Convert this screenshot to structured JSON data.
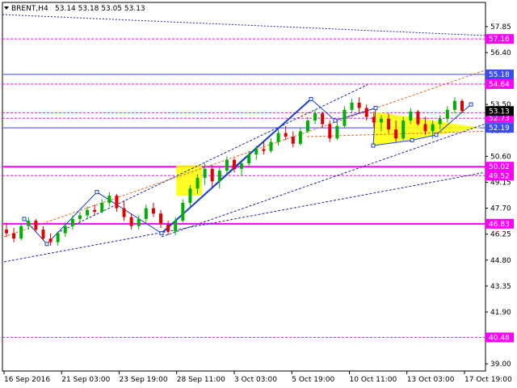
{
  "header": {
    "symbol": "BRENT,H4",
    "ohlc": "53.14 53.18 53.05 53.13"
  },
  "chart_data": {
    "type": "candlestick",
    "price_scale": [
      57.85,
      56.4,
      55.0,
      53.5,
      52.05,
      50.6,
      49.15,
      47.7,
      46.25,
      44.8,
      43.35,
      41.9,
      40.45,
      39.0
    ],
    "ylim": [
      38.6,
      59.2
    ],
    "x_ticks": [
      "16 Sep 2016",
      "21 Sep 03:00",
      "23 Sep 19:00",
      "28 Sep 11:00",
      "3 Oct 03:00",
      "5 Oct 19:00",
      "10 Oct 11:00",
      "13 Oct 03:00",
      "17 Oct 19:00"
    ],
    "levels": [
      {
        "value": 57.16,
        "label": "57.16",
        "color": "#ff00ff",
        "style": "dashed"
      },
      {
        "value": 55.18,
        "label": "55.18",
        "color": "#3b4cf0",
        "style": "solid"
      },
      {
        "value": 54.64,
        "label": "54.64",
        "color": "#ff00ff",
        "style": "dashed"
      },
      {
        "value": 53.03,
        "label": "53.03",
        "color": "#ff00ff",
        "style": "dashed"
      },
      {
        "value": 52.73,
        "label": "52.73",
        "color": "#ff00ff",
        "style": "dashed"
      },
      {
        "value": 52.19,
        "label": "52.19",
        "color": "#3b4cf0",
        "style": "solid"
      },
      {
        "value": 50.02,
        "label": "50.02",
        "color": "#ff00ff",
        "style": "solid"
      },
      {
        "value": 49.52,
        "label": "49.52",
        "color": "#ff00ff",
        "style": "dashed"
      },
      {
        "value": 46.83,
        "label": "46.83",
        "color": "#ff00ff",
        "style": "solid"
      },
      {
        "value": 40.48,
        "label": "40.48",
        "color": "#ff00ff",
        "style": "dashed"
      }
    ],
    "current_price": {
      "value": 53.13,
      "label": "53.13"
    },
    "colors": {
      "bull": "#00b000",
      "bear": "#e00000",
      "wave": "#1a3fd1",
      "channel": "#1a2aa0",
      "fan": "#e06a2a",
      "pattern_fill": "#ffff00"
    },
    "candles": [
      [
        46.5,
        46.9,
        46.1,
        46.3
      ],
      [
        46.3,
        46.6,
        45.8,
        46.0
      ],
      [
        46.0,
        46.8,
        45.9,
        46.7
      ],
      [
        46.7,
        47.2,
        46.5,
        47.0
      ],
      [
        47.0,
        47.1,
        46.4,
        46.5
      ],
      [
        46.5,
        46.7,
        45.9,
        46.0
      ],
      [
        46.0,
        46.3,
        45.6,
        45.8
      ],
      [
        45.8,
        46.4,
        45.6,
        46.3
      ],
      [
        46.3,
        46.9,
        46.1,
        46.7
      ],
      [
        46.7,
        47.3,
        46.5,
        47.1
      ],
      [
        47.1,
        47.5,
        46.8,
        47.3
      ],
      [
        47.3,
        47.8,
        47.1,
        47.6
      ],
      [
        47.6,
        47.9,
        47.3,
        47.5
      ],
      [
        47.5,
        48.2,
        47.4,
        48.0
      ],
      [
        48.0,
        48.6,
        47.8,
        48.4
      ],
      [
        48.4,
        48.5,
        47.5,
        47.7
      ],
      [
        47.7,
        48.1,
        47.0,
        47.2
      ],
      [
        47.2,
        47.4,
        46.5,
        46.7
      ],
      [
        46.7,
        47.3,
        46.5,
        47.1
      ],
      [
        47.1,
        47.9,
        46.9,
        47.7
      ],
      [
        47.7,
        48.0,
        47.2,
        47.4
      ],
      [
        47.4,
        47.6,
        46.6,
        46.8
      ],
      [
        46.8,
        47.0,
        46.2,
        46.4
      ],
      [
        46.4,
        47.2,
        46.2,
        47.0
      ],
      [
        47.0,
        48.2,
        46.9,
        48.0
      ],
      [
        48.0,
        49.0,
        47.8,
        48.8
      ],
      [
        48.8,
        49.6,
        48.5,
        49.4
      ],
      [
        49.4,
        50.2,
        49.0,
        49.9
      ],
      [
        49.9,
        50.1,
        48.9,
        49.2
      ],
      [
        49.2,
        50.0,
        48.8,
        49.8
      ],
      [
        49.8,
        50.6,
        49.6,
        50.4
      ],
      [
        50.4,
        50.5,
        49.7,
        49.9
      ],
      [
        49.9,
        50.3,
        49.5,
        50.2
      ],
      [
        50.2,
        50.9,
        50.0,
        50.7
      ],
      [
        50.7,
        51.2,
        50.4,
        51.0
      ],
      [
        51.0,
        51.4,
        50.7,
        50.9
      ],
      [
        50.9,
        51.6,
        50.8,
        51.4
      ],
      [
        51.4,
        52.1,
        51.2,
        51.9
      ],
      [
        51.9,
        52.3,
        51.5,
        51.7
      ],
      [
        51.7,
        52.0,
        51.1,
        51.3
      ],
      [
        51.3,
        52.2,
        51.2,
        52.0
      ],
      [
        52.0,
        52.8,
        51.9,
        52.6
      ],
      [
        52.6,
        53.2,
        52.4,
        53.0
      ],
      [
        53.0,
        53.1,
        52.2,
        52.4
      ],
      [
        52.4,
        52.6,
        51.4,
        51.6
      ],
      [
        51.6,
        52.5,
        51.5,
        52.3
      ],
      [
        52.3,
        53.4,
        52.2,
        53.2
      ],
      [
        53.2,
        53.8,
        53.0,
        53.6
      ],
      [
        53.6,
        53.9,
        53.0,
        53.3
      ],
      [
        53.3,
        53.5,
        52.6,
        52.8
      ],
      [
        52.8,
        53.1,
        52.2,
        52.5
      ],
      [
        52.5,
        52.9,
        52.0,
        52.7
      ],
      [
        52.7,
        53.0,
        51.9,
        52.1
      ],
      [
        52.1,
        52.6,
        51.4,
        51.6
      ],
      [
        51.6,
        52.8,
        51.5,
        52.6
      ],
      [
        52.6,
        53.3,
        52.4,
        53.1
      ],
      [
        53.1,
        53.2,
        52.3,
        52.4
      ],
      [
        52.4,
        52.8,
        51.8,
        52.0
      ],
      [
        52.0,
        52.6,
        51.6,
        52.4
      ],
      [
        52.4,
        52.9,
        52.1,
        52.7
      ],
      [
        52.7,
        53.4,
        52.5,
        53.2
      ],
      [
        53.2,
        53.9,
        53.0,
        53.7
      ],
      [
        53.7,
        53.8,
        53.0,
        53.13
      ]
    ]
  }
}
